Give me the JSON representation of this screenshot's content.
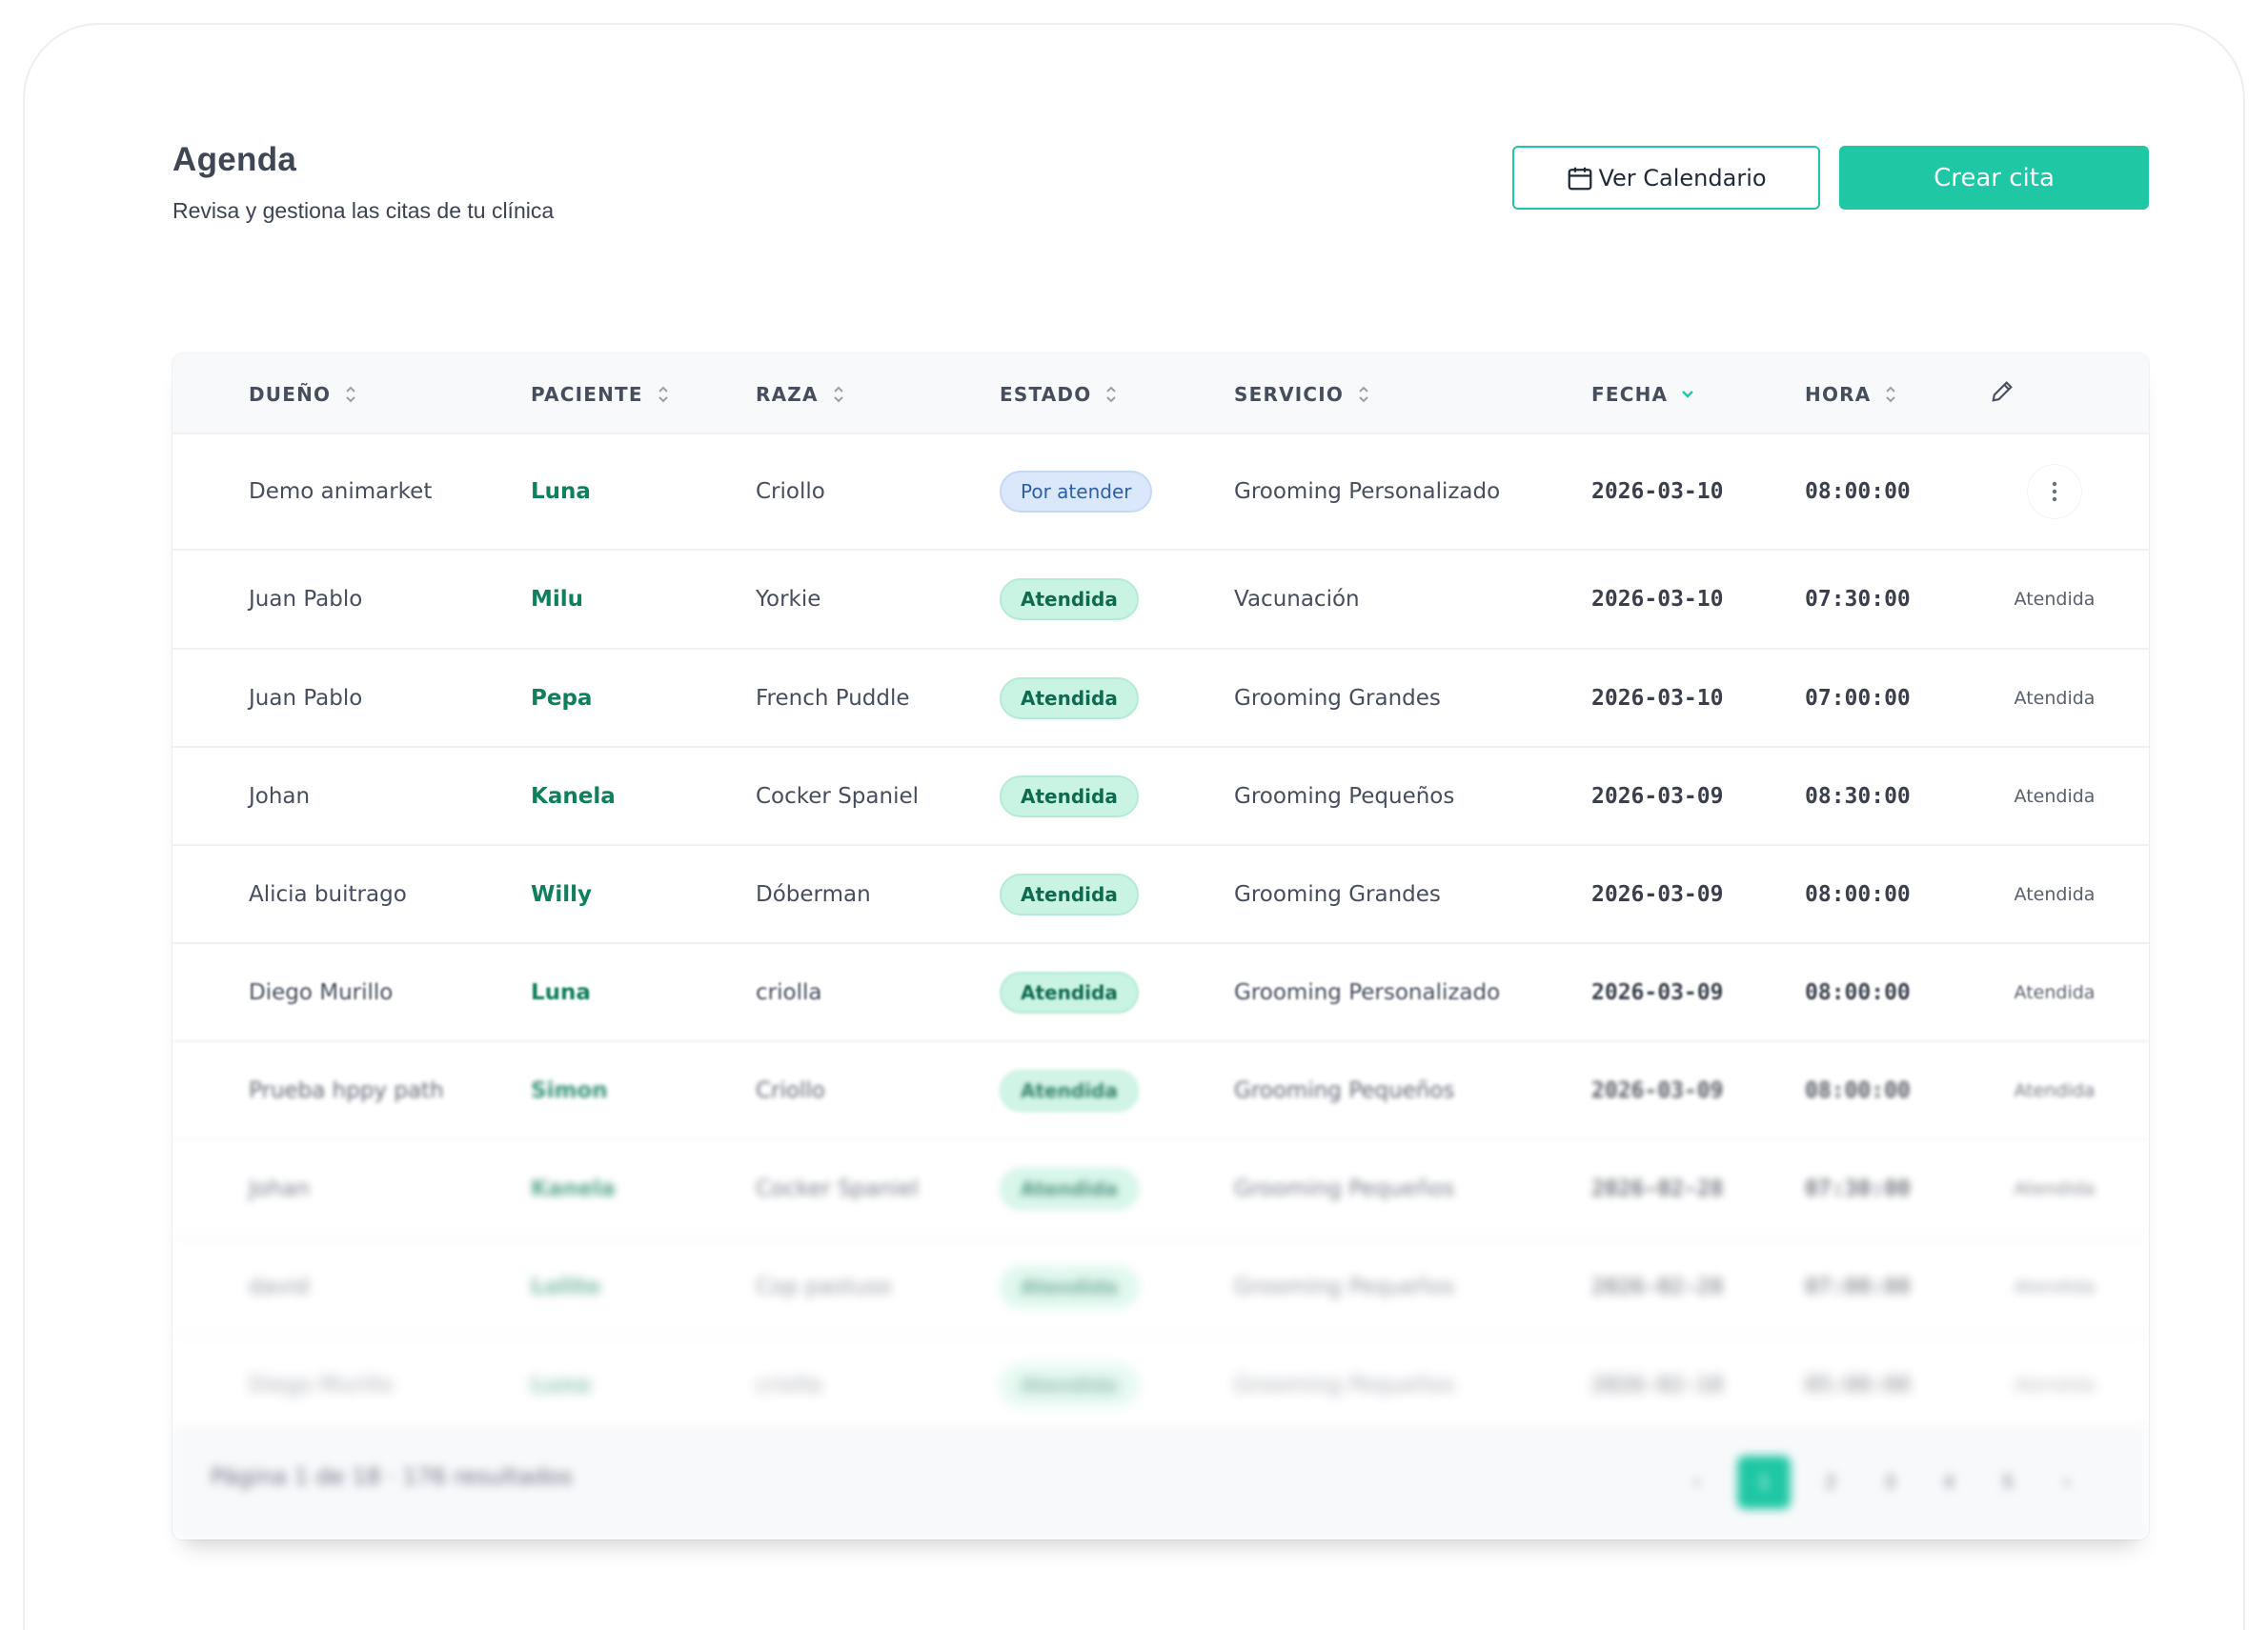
{
  "header": {
    "title": "Agenda",
    "subtitle": "Revisa y gestiona las citas de tu clínica",
    "calendar_button": "Ver Calendario",
    "create_button": "Crear cita"
  },
  "table": {
    "columns": [
      "DUEÑO",
      "PACIENTE",
      "RAZA",
      "ESTADO",
      "SERVICIO",
      "FECHA",
      "HORA"
    ],
    "sort": {
      "column": "FECHA",
      "direction": "desc"
    },
    "rows": [
      {
        "owner": "Demo animarket",
        "patient": "Luna",
        "breed": "Criollo",
        "status": "Por atender",
        "status_type": "pending",
        "service": "Grooming Personalizado",
        "date": "2026-03-10",
        "time": "08:00:00",
        "action": ""
      },
      {
        "owner": "Juan Pablo",
        "patient": "Milu",
        "breed": "Yorkie",
        "status": "Atendida",
        "status_type": "done",
        "service": "Vacunación",
        "date": "2026-03-10",
        "time": "07:30:00",
        "action": "Atendida"
      },
      {
        "owner": "Juan Pablo",
        "patient": "Pepa",
        "breed": "French Puddle",
        "status": "Atendida",
        "status_type": "done",
        "service": "Grooming Grandes",
        "date": "2026-03-10",
        "time": "07:00:00",
        "action": "Atendida"
      },
      {
        "owner": "Johan",
        "patient": "Kanela",
        "breed": "Cocker Spaniel",
        "status": "Atendida",
        "status_type": "done",
        "service": "Grooming Pequeños",
        "date": "2026-03-09",
        "time": "08:30:00",
        "action": "Atendida"
      },
      {
        "owner": "Alicia buitrago",
        "patient": "Willy",
        "breed": "Dóberman",
        "status": "Atendida",
        "status_type": "done",
        "service": "Grooming Grandes",
        "date": "2026-03-09",
        "time": "08:00:00",
        "action": "Atendida"
      },
      {
        "owner": "Diego Murillo",
        "patient": "Luna",
        "breed": "criolla",
        "status": "Atendida",
        "status_type": "done",
        "service": "Grooming Personalizado",
        "date": "2026-03-09",
        "time": "08:00:00",
        "action": "Atendida"
      },
      {
        "owner": "Prueba hppy path",
        "patient": "Simon",
        "breed": "Criollo",
        "status": "Atendida",
        "status_type": "done",
        "service": "Grooming Pequeños",
        "date": "2026-03-09",
        "time": "08:00:00",
        "action": "Atendida"
      },
      {
        "owner": "Johan",
        "patient": "Kanela",
        "breed": "Cocker Spaniel",
        "status": "Atendida",
        "status_type": "done",
        "service": "Grooming Pequeños",
        "date": "2026-02-28",
        "time": "07:30:00",
        "action": "Atendida"
      },
      {
        "owner": "david",
        "patient": "Lolito",
        "breed": "Cop pastuso",
        "status": "Atendida",
        "status_type": "done",
        "service": "Grooming Pequeños",
        "date": "2026-02-28",
        "time": "07:00:00",
        "action": "Atendida"
      },
      {
        "owner": "Diego Murillo",
        "patient": "Luna",
        "breed": "criolla",
        "status": "Atendida",
        "status_type": "done",
        "service": "Grooming Pequeños",
        "date": "2026-02-10",
        "time": "05:00:00",
        "action": "Atendida"
      }
    ]
  },
  "footer": {
    "summary": "Página 1 de 18 · 176 resultados",
    "pages": [
      "‹",
      "1",
      "2",
      "3",
      "4",
      "5",
      "›"
    ]
  },
  "colors": {
    "accent": "#1fc7a4",
    "patient": "#0f7f5d",
    "pending_bg": "#dbe8fb",
    "done_bg": "#c9f3e2"
  }
}
